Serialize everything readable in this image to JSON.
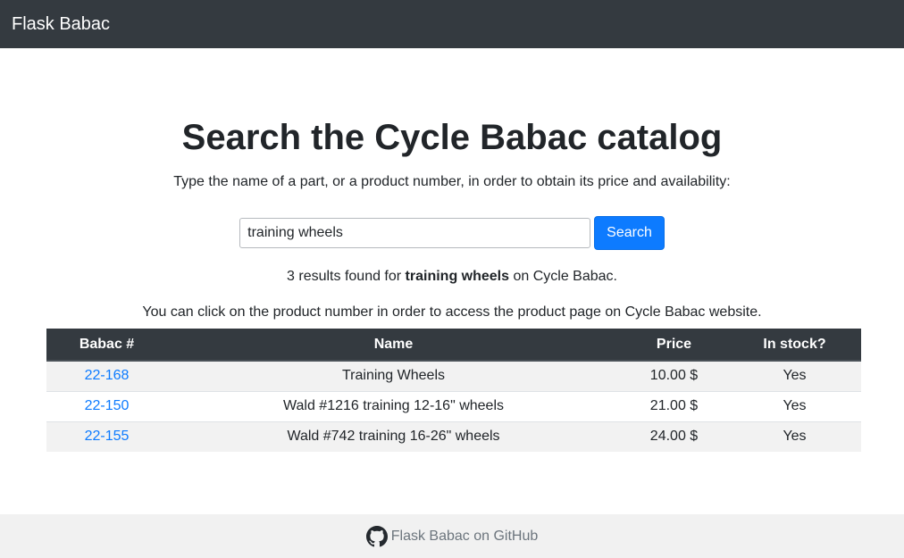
{
  "navbar": {
    "brand": "Flask Babac"
  },
  "main": {
    "title": "Search the Cycle Babac catalog",
    "subtitle": "Type the name of a part, or a product number, in order to obtain its price and availability:"
  },
  "search": {
    "value": "training wheels",
    "button_label": "Search"
  },
  "results": {
    "count_prefix": "3 results found for ",
    "query": "training wheels",
    "suffix": " on Cycle Babac.",
    "hint": "You can click on the product number in order to access the product page on Cycle Babac website."
  },
  "table": {
    "headers": [
      "Babac #",
      "Name",
      "Price",
      "In stock?"
    ],
    "rows": [
      {
        "number": "22-168",
        "name": "Training Wheels",
        "price": "10.00 $",
        "stock": "Yes"
      },
      {
        "number": "22-150",
        "name": "Wald #1216 training 12-16\" wheels",
        "price": "21.00 $",
        "stock": "Yes"
      },
      {
        "number": "22-155",
        "name": "Wald #742 training 16-26\" wheels",
        "price": "24.00 $",
        "stock": "Yes"
      }
    ]
  },
  "footer": {
    "link_label": "Flask Babac on GitHub",
    "icon": "github-icon"
  },
  "colors": {
    "navbar": "#343a40",
    "primary": "#0d7bff",
    "footer": "#f1f1f1"
  }
}
